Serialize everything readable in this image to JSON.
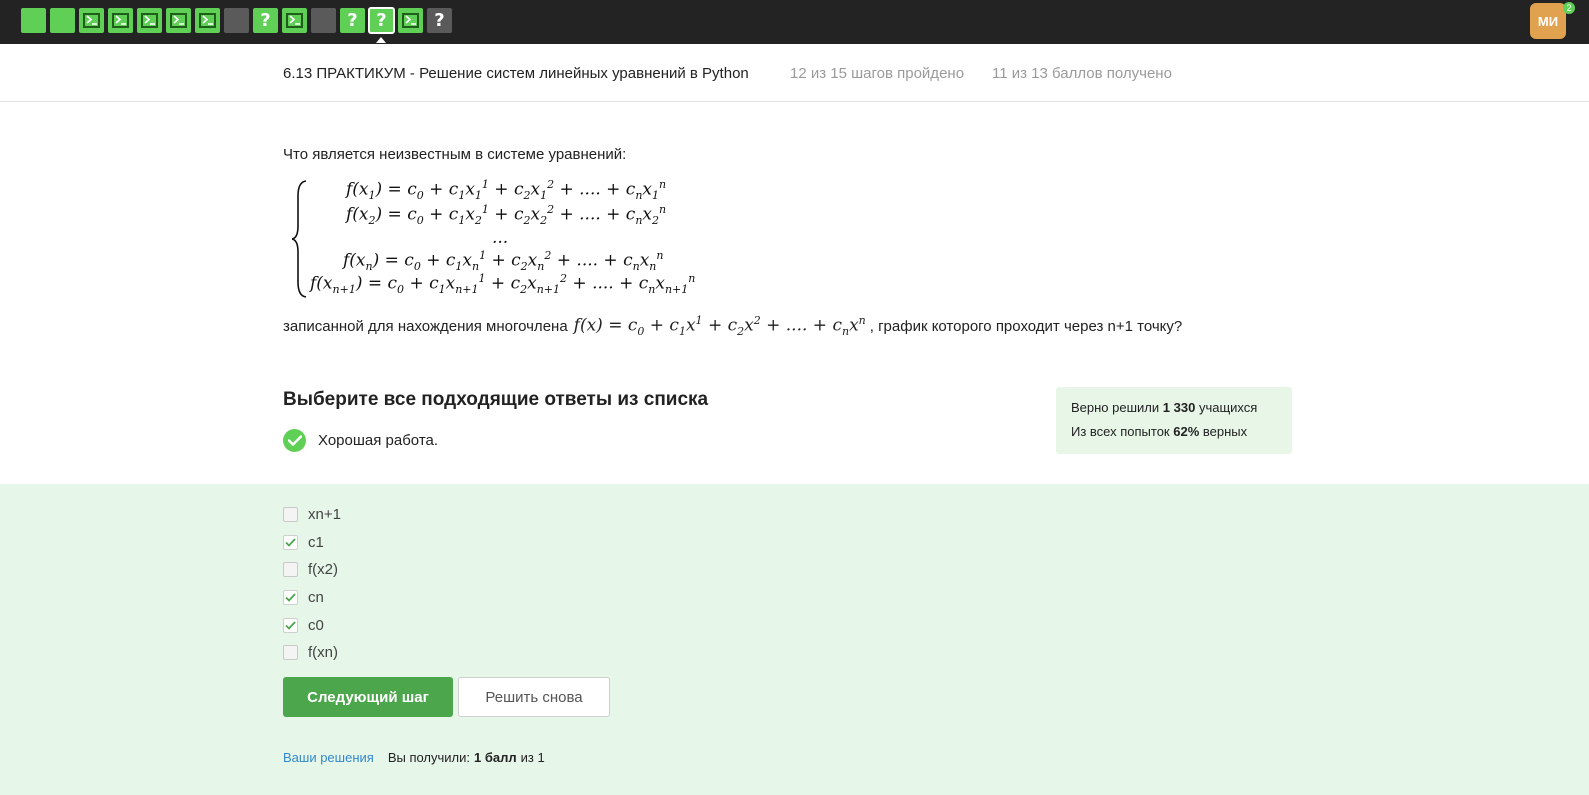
{
  "topbar": {
    "steps": [
      {
        "type": "solved",
        "icon": "filled-square"
      },
      {
        "type": "solved",
        "icon": "filled-square"
      },
      {
        "type": "solved",
        "icon": "terminal-icon"
      },
      {
        "type": "solved",
        "icon": "terminal-icon"
      },
      {
        "type": "solved",
        "icon": "terminal-icon"
      },
      {
        "type": "solved",
        "icon": "terminal-icon"
      },
      {
        "type": "solved",
        "icon": "terminal-icon"
      },
      {
        "type": "unsolved",
        "icon": "filled-square"
      },
      {
        "type": "solved",
        "icon": "question-icon",
        "glyph": "?"
      },
      {
        "type": "solved",
        "icon": "terminal-icon"
      },
      {
        "type": "unsolved",
        "icon": "filled-square"
      },
      {
        "type": "solved",
        "icon": "question-icon",
        "glyph": "?"
      },
      {
        "type": "solved-active",
        "icon": "question-icon",
        "glyph": "?"
      },
      {
        "type": "solved",
        "icon": "terminal-icon"
      },
      {
        "type": "unsolved",
        "icon": "question-icon",
        "glyph": "?"
      }
    ],
    "avatar_initials": "МИ",
    "avatar_badge": "2"
  },
  "header": {
    "title": "6.13 ПРАКТИКУМ - Решение систем линейных уравнений в Python",
    "progress": "12 из 15 шагов пройдено",
    "score": "11 из 13 баллов  получено"
  },
  "question": {
    "intro": "Что является неизвестным в системе уравнений:",
    "tail_before": "записанной для нахождения многочлена",
    "tail_after": ", график которого проходит через n+1 точку?"
  },
  "instruction": "Выберите все подходящие ответы из списка",
  "feedback": "Хорошая работа.",
  "stats": {
    "solved_prefix": "Верно решили",
    "solved_count": "1 330",
    "solved_suffix": "учащихся",
    "attempts_prefix": "Из всех попыток",
    "attempts_percent": "62%",
    "attempts_suffix": "верных"
  },
  "options": [
    {
      "label": "xn+1",
      "checked": false
    },
    {
      "label": "c1",
      "checked": true
    },
    {
      "label": "f(x2)",
      "checked": false
    },
    {
      "label": "cn",
      "checked": true
    },
    {
      "label": "c0",
      "checked": true
    },
    {
      "label": "f(xn)",
      "checked": false
    }
  ],
  "buttons": {
    "next": "Следующий шаг",
    "retry": "Решить снова"
  },
  "footer": {
    "solutions_link": "Ваши решения",
    "result_prefix": "Вы получили:",
    "result_value": "1 балл",
    "result_suffix": "из 1"
  },
  "colors": {
    "green": "#5fcf55",
    "button_green": "#4ca64c",
    "answers_bg": "#e6f6e8",
    "topbar": "#232323"
  }
}
